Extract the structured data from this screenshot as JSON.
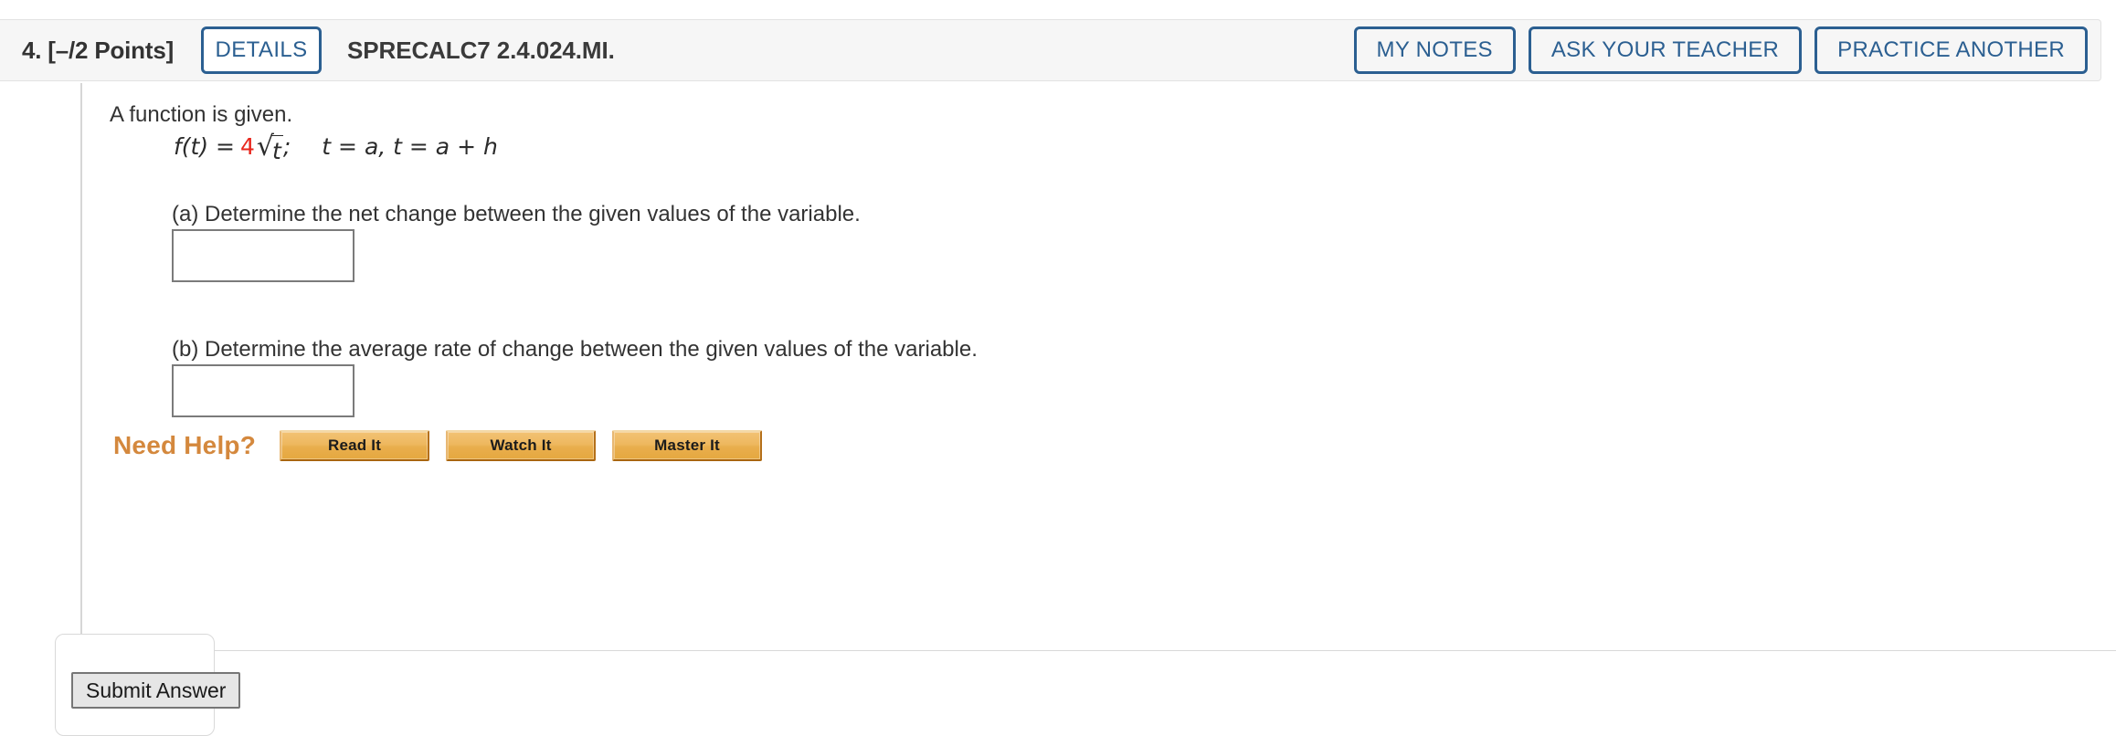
{
  "header": {
    "points_label": "4.  [–/2 Points]",
    "details_label": "DETAILS",
    "assignment_code": "SPRECALC7 2.4.024.MI.",
    "actions": [
      {
        "label": "MY NOTES"
      },
      {
        "label": "ASK YOUR TEACHER"
      },
      {
        "label": "PRACTICE ANOTHER"
      }
    ]
  },
  "question": {
    "intro": "A function is given.",
    "formula": {
      "lhs": "f(t) = ",
      "coefficient": "4",
      "radical_symbol": "√",
      "radicand": "t",
      "semicolon": ";",
      "conditions": "t = a, t = a + h"
    },
    "parts": [
      {
        "label": "(a) Determine the net change between the given values of the variable.",
        "answer_value": "",
        "answer_placeholder": ""
      },
      {
        "label": "(b) Determine the average rate of change between the given values of the variable.",
        "answer_value": "",
        "answer_placeholder": ""
      }
    ]
  },
  "need_help": {
    "label": "Need Help?",
    "buttons": [
      {
        "label": "Read It"
      },
      {
        "label": "Watch It"
      },
      {
        "label": "Master It"
      }
    ]
  },
  "footer": {
    "submit_label": "Submit Answer"
  },
  "colors": {
    "accent_blue": "#2b5f91",
    "need_help_orange": "#d4883d",
    "coefficient_red": "#e8261c",
    "header_background": "#f6f6f6",
    "help_button_orange": "#eeb85f"
  }
}
